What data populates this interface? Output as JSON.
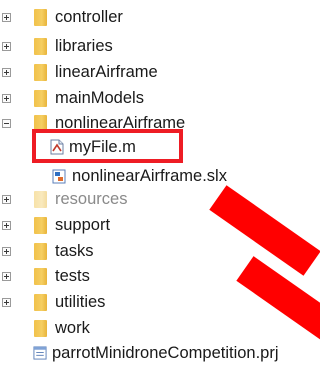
{
  "tree": {
    "items": [
      {
        "label": "controller",
        "expander": "plus"
      },
      {
        "label": "libraries",
        "expander": "plus"
      },
      {
        "label": "linearAirframe",
        "expander": "plus"
      },
      {
        "label": "mainModels",
        "expander": "plus"
      },
      {
        "label": "nonlinearAirframe",
        "expander": "minus"
      },
      {
        "label": "resources",
        "expander": "plus",
        "faded": true
      },
      {
        "label": "support",
        "expander": "plus"
      },
      {
        "label": "tasks",
        "expander": "plus"
      },
      {
        "label": "tests",
        "expander": "plus"
      },
      {
        "label": "utilities",
        "expander": "plus"
      },
      {
        "label": "work",
        "expander": "none"
      }
    ],
    "nonlinearAirframe_children": [
      {
        "label": "myFile.m",
        "icon": "matlab-script-icon"
      },
      {
        "label": "nonlinearAirframe.slx",
        "icon": "simulink-model-icon"
      }
    ],
    "project_file": {
      "label": "parrotMinidroneCompetition.prj",
      "icon": "project-file-icon"
    }
  },
  "annotation": {
    "highlight_color": "#ee1c24",
    "mark_color": "#ff0000"
  }
}
